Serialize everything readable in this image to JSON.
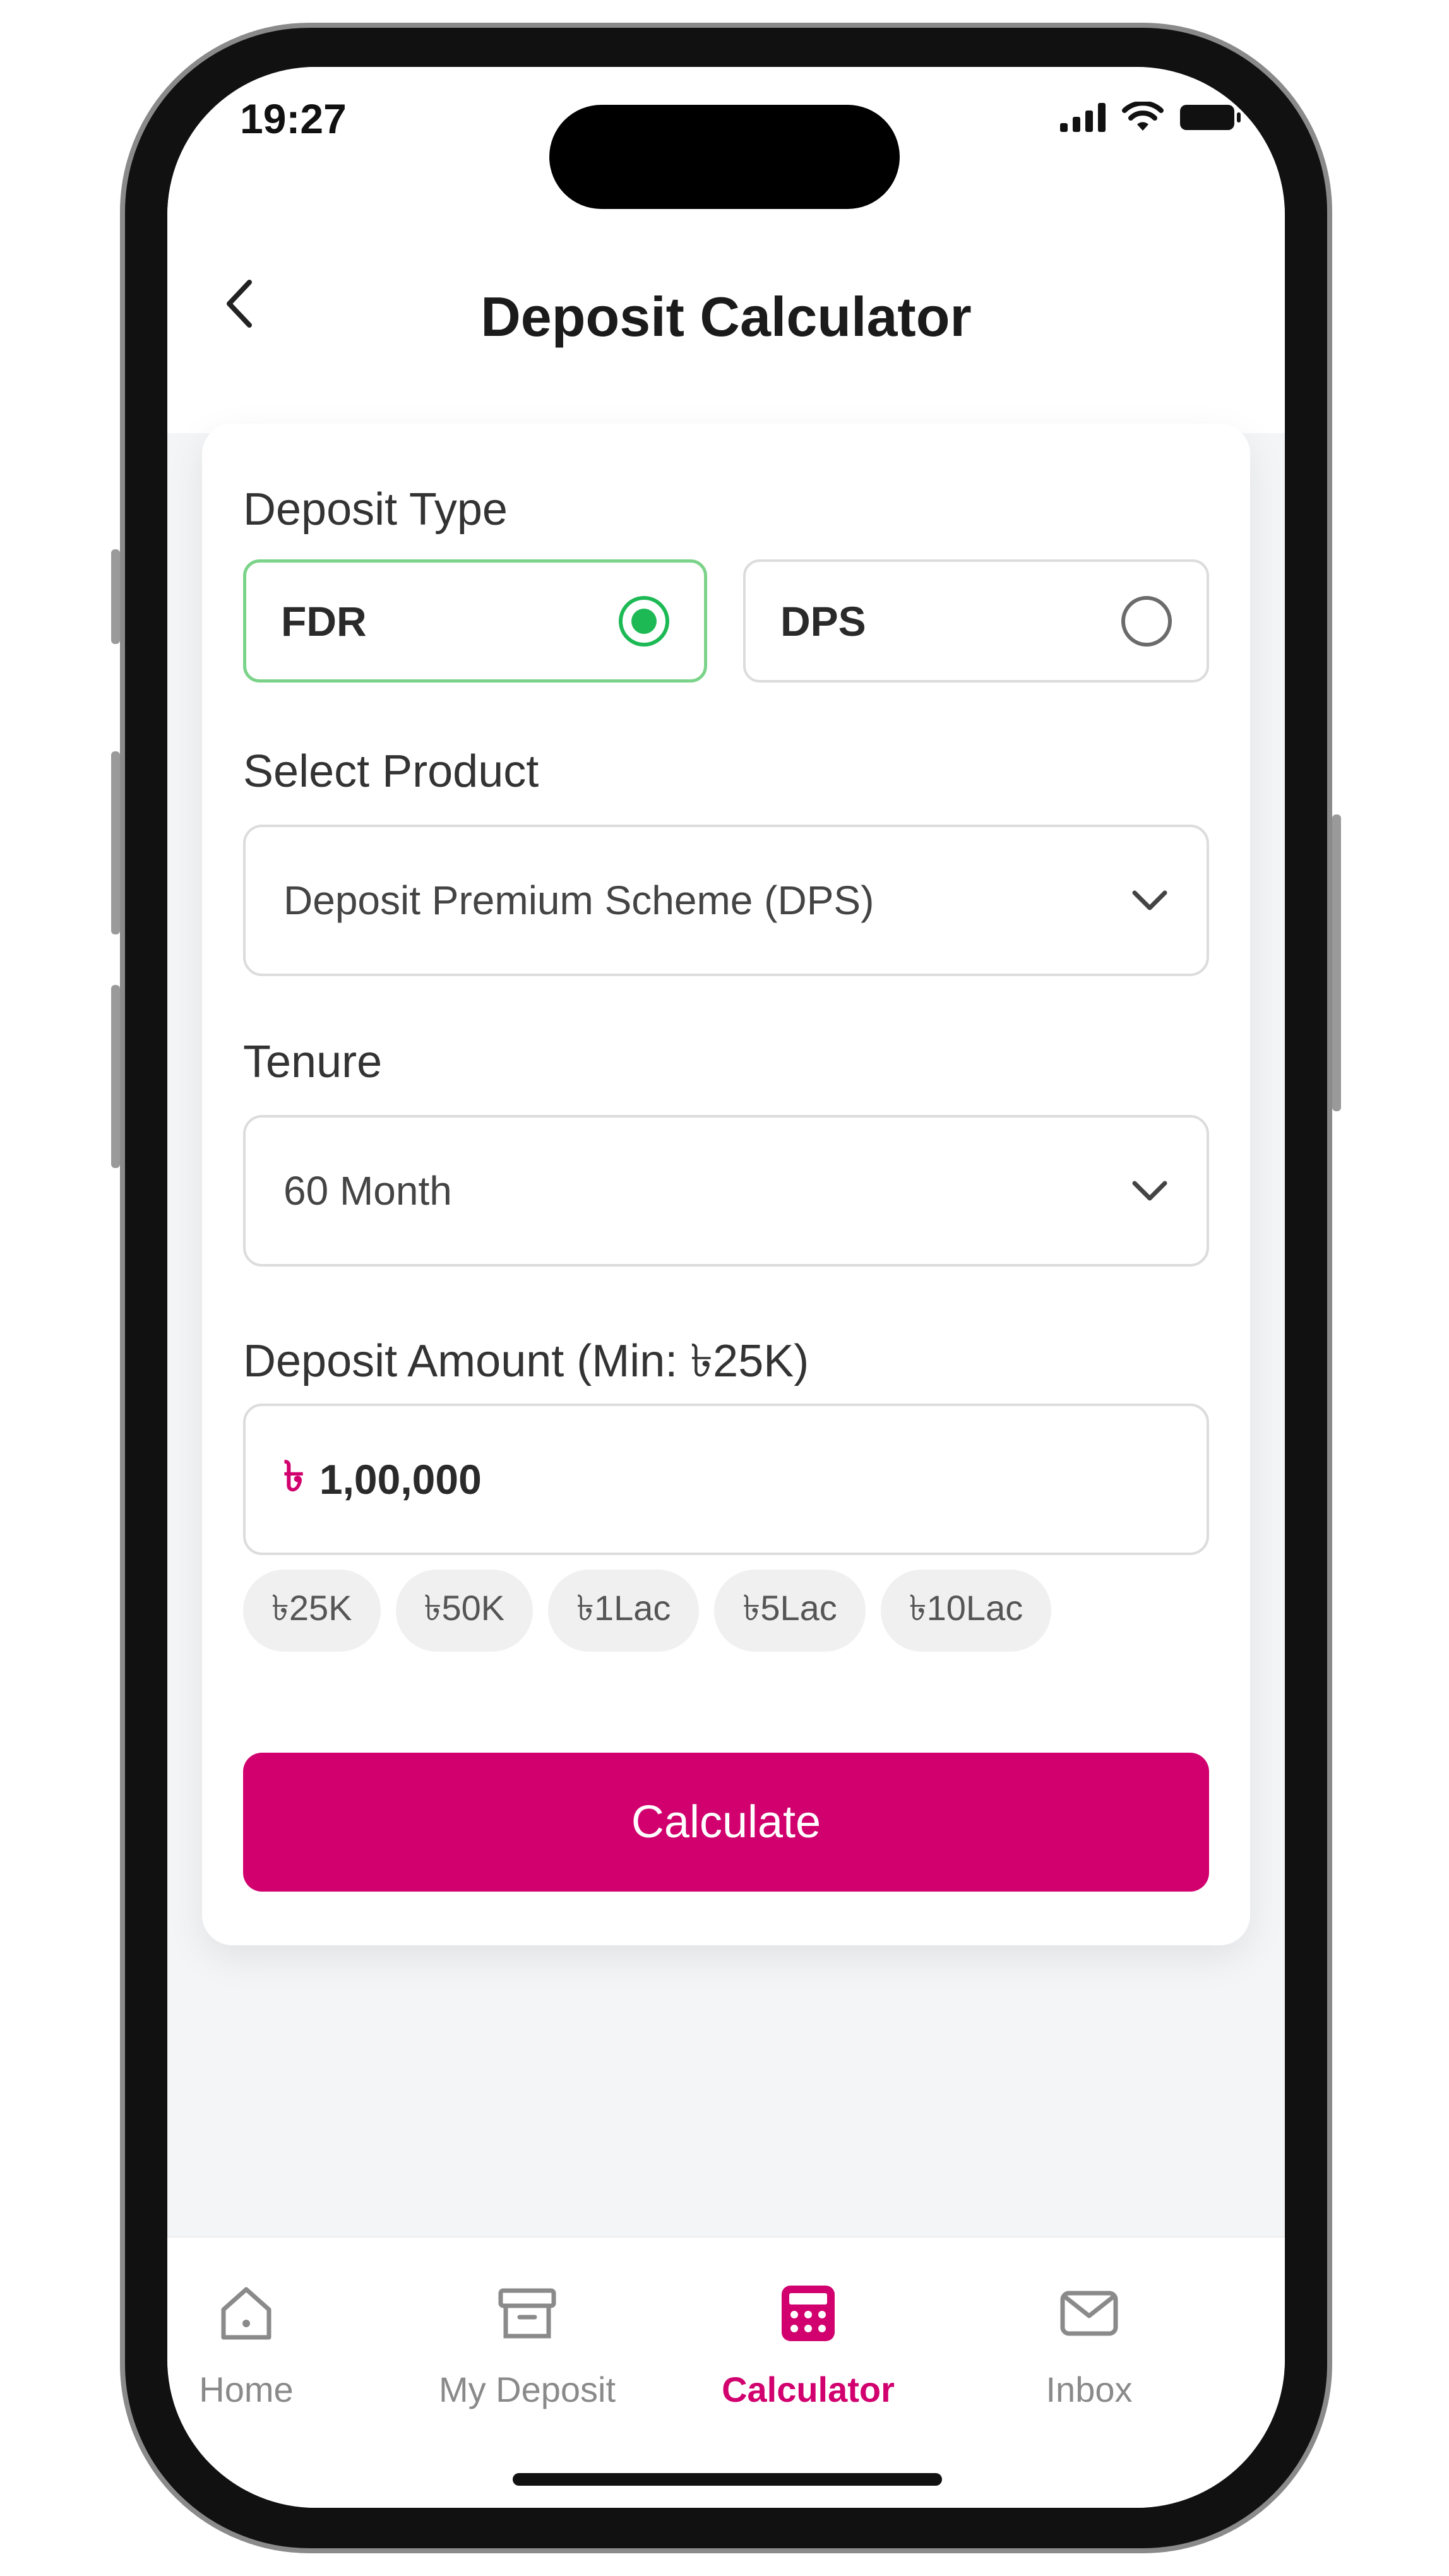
{
  "status": {
    "time": "19:27"
  },
  "header": {
    "title": "Deposit Calculator"
  },
  "form": {
    "deposit_type_label": "Deposit Type",
    "options": [
      {
        "label": "FDR",
        "selected": true
      },
      {
        "label": "DPS",
        "selected": false
      }
    ],
    "product_label": "Select Product",
    "product_value": "Deposit Premium Scheme (DPS)",
    "tenure_label": "Tenure",
    "tenure_value": "60 Month",
    "amount_label": "Deposit Amount (Min: ৳25K)",
    "currency_symbol": "৳",
    "amount_value": "1,00,000",
    "chips": [
      "৳25K",
      "৳50K",
      "৳1Lac",
      "৳5Lac",
      "৳10Lac"
    ],
    "calculate_label": "Calculate"
  },
  "tabbar": {
    "items": [
      {
        "label": "Home",
        "icon": "home-icon"
      },
      {
        "label": "My Deposit",
        "icon": "archive-icon"
      },
      {
        "label": "Calculator",
        "icon": "calculator-icon",
        "active": true
      },
      {
        "label": "Inbox",
        "icon": "mail-icon"
      }
    ]
  },
  "colors": {
    "accent": "#d1006e",
    "selected": "#1db954"
  }
}
